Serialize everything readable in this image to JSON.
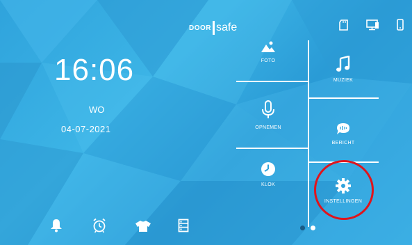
{
  "header": {
    "logo_left": "DOOR",
    "logo_right": "safe"
  },
  "status_icons": [
    "sd-card-icon",
    "monitor-icon",
    "phone-icon"
  ],
  "clock": {
    "time": "16:06",
    "day": "WO",
    "date": "04-07-2021"
  },
  "tiles": {
    "foto": "FOTO",
    "muziek": "MUZIEK",
    "opnemen": "OPNEMEN",
    "bericht": "BERICHT",
    "klok": "KLOK",
    "instellingen": "INSTELLINGEN"
  },
  "bottom_icons": [
    "bell-icon",
    "alarm-clock-icon",
    "shirt-icon",
    "list-icon"
  ],
  "pager": {
    "pages": 2,
    "current": 2
  },
  "colors": {
    "highlight": "#e0141c",
    "background": "#3aaee3"
  }
}
